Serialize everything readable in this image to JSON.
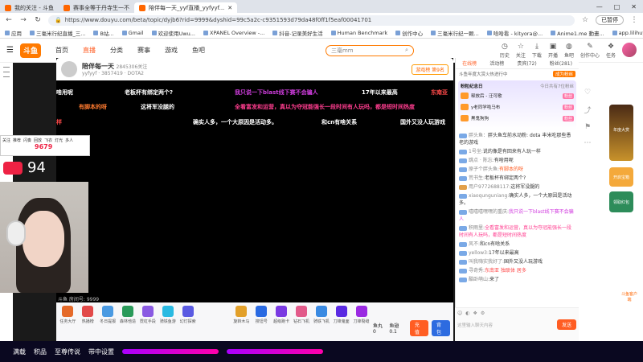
{
  "browser": {
    "tabs": [
      {
        "title": "我的关注 - 斗鱼"
      },
      {
        "title": "赛事全等于丹寺生一不"
      },
      {
        "title": "陪伴每一天_yyf直播_yyfyyf..."
      }
    ],
    "window_controls": [
      "—",
      "□",
      "✕"
    ],
    "url": "https://www.douyu.com/beta/topic/dyjb6?rid=9999&dyshid=99c5a2c-c9351593d79da48f0ff1f5eaf00041701",
    "profile_label": "已暂停",
    "bookmarks": [
      "应用",
      "三毫米行纪直播_三...",
      "B站...",
      "Gmail",
      "欢迎使用Uwu...",
      "XPANEL Overview -...",
      "抖音-记录美好生活",
      "Human Benchmark",
      "创作中心",
      "三毫米行纪一颗...",
      "哈哈看 - kityora@...",
      "Anime1.me 動畫...",
      "app.lilihuyu.com/..."
    ]
  },
  "site": {
    "logo": "斗鱼",
    "nav": [
      "首页",
      "直播",
      "分类",
      "赛事",
      "游戏",
      "鱼吧"
    ],
    "nav_active": 1,
    "search_placeholder": "三毫mm",
    "header_icons": [
      {
        "icon": "clock-icon",
        "label": "历史"
      },
      {
        "icon": "star-icon",
        "label": "关注"
      },
      {
        "icon": "download-icon",
        "label": "下载"
      },
      {
        "icon": "broadcast-icon",
        "label": "开播"
      },
      {
        "icon": "fish-icon",
        "label": "鱼吧"
      },
      {
        "icon": "pen-icon",
        "label": "创作中心"
      },
      {
        "icon": "gift-icon",
        "label": "任务"
      }
    ]
  },
  "stream": {
    "title": "陪伴每一天",
    "followers": "2845306关注",
    "anchor": "yyfyyf",
    "hot": "3857419",
    "category": "DOTA2",
    "rank": "游戏榜 第9名",
    "room_id": "斗鱼 房间号: 9999",
    "heart_rate": "94",
    "danmu": [
      {
        "text": "啥用呢",
        "color": "#ffffff"
      },
      {
        "text": "老板杯有绑定两个?",
        "color": "#ffffff"
      },
      {
        "text": "我只说一下blast线下赛不会骗人",
        "color": "#d13ddf"
      },
      {
        "text": "17年以来最高",
        "color": "#ffffff"
      },
      {
        "text": "东南亚",
        "color": "#ff4a4a"
      },
      {
        "text": "有脚本的呀",
        "color": "#ff7a2f"
      },
      {
        "text": "这将军没腿的",
        "color": "#ffffff"
      },
      {
        "text": "全看富发和运营，真以为夺冠能强长一段时间有人玩吗，都是短时间热度",
        "color": "#ff3d8f"
      },
      {
        "text": "样",
        "color": "#ff4a4a"
      },
      {
        "text": "确实人多，一个大原因是活动多。",
        "color": "#ffffff"
      },
      {
        "text": "和cn有啥关系",
        "color": "#ffffff"
      },
      {
        "text": "国外又没人玩游戏",
        "color": "#ffffff"
      }
    ],
    "overlay_text": [
      "关注",
      "推荐",
      "闪奏",
      "回放",
      "飞衣",
      "灯光",
      "多人"
    ],
    "overlay_number": "9679",
    "gifts": [
      {
        "label": "任务大厅",
        "color": "#e56a2a"
      },
      {
        "label": "热播榜",
        "color": "#e24a4a"
      },
      {
        "label": "冬日提报",
        "color": "#4a9ae2"
      },
      {
        "label": "森林他造",
        "color": "#2a9a5a"
      },
      {
        "label": "霓虹手段",
        "color": "#8a5ae2"
      },
      {
        "label": "骑铁鱼游",
        "color": "#2abae2"
      },
      {
        "label": "幻灯探索",
        "color": "#5a5ae2"
      },
      {
        "label": "旋转木马",
        "color": "#e2a02a"
      },
      {
        "label": "搜坦号",
        "color": "#2a6ae2"
      },
      {
        "label": "超级跑卡",
        "color": "#7a3ae2"
      },
      {
        "label": "钻石飞机",
        "color": "#e25a8a"
      },
      {
        "label": "骑铁飞机",
        "color": "#3a8ae2"
      },
      {
        "label": "刀锋鬼面",
        "color": "#5a2ae2"
      },
      {
        "label": "刀锋裂缝",
        "color": "#9a2ae2"
      }
    ],
    "fish_balls": "鱼丸 0",
    "fish_wings": "鱼翅 0.1",
    "charge_label": "充值",
    "bag_label": "背包"
  },
  "chat": {
    "tabs": [
      "在线榜",
      "活动榜",
      "贵宾(72)",
      "粉丝(281)"
    ],
    "active_tab": 0,
    "subline": "斗鱼年度大赏火热进行中",
    "follow_label": "成为粉丝",
    "fanclub_title": "粉粒纪念日",
    "fanclub_date": "今日共有7位粉丝",
    "fanclub_rows": [
      {
        "name": "释放后 - 汪可歌",
        "tag": "粉丝"
      },
      {
        "name": "y老同学啦马布",
        "tag": "粉丝"
      },
      {
        "name": "黑鬼狗狗",
        "tag": "粉丝"
      }
    ],
    "messages": [
      {
        "user": "胖头鱼：",
        "text": "胖头鱼车前水动粉: dota 丰米吃那些愚老的游戏"
      },
      {
        "user": "1号坐:",
        "text": "说的像是有回来有人玩一样"
      },
      {
        "user": "跳点 · 陈忘:",
        "text": "有啥用呢"
      },
      {
        "user": "原子个胖头鱼:",
        "text": "有脚本的呀"
      },
      {
        "user": "荒书生:",
        "text": "老板杯有绑定两个?"
      },
      {
        "user": "用户9772688117:",
        "text": "这将军没腿的"
      },
      {
        "user": "xiaoqunguniang:",
        "text": "确实人多，一个大原因是活动多。"
      },
      {
        "user": "嘻嘻嘻嘿嘿的重庆:",
        "text": "我只说一下blast线下赛不会骗人"
      },
      {
        "user": "积雨里:",
        "text": "全看富发和运营，真以为夺冠能强长一段时间有人玩吗，都是短时间热度"
      },
      {
        "user": "风不:",
        "text": "和cn有啥关系"
      },
      {
        "user": "yellow3:",
        "text": "17年以来最高"
      },
      {
        "user": "叫我嗨实我好了:",
        "text": "国外又没人玩游戏"
      },
      {
        "user": "寻奇秀:",
        "text": "东南亚 独联体 居多"
      },
      {
        "user": "酷卧萌山:",
        "text": "来了"
      }
    ],
    "input_placeholder": "这里输入聊天内容",
    "send_label": "发送"
  },
  "side": {
    "ad1": "年度大赏",
    "ad2": "开启宝箱",
    "ad3": "领取红包",
    "float_label": "斗鱼客户端"
  },
  "bottom": [
    "满载",
    "积品",
    "至尊传说",
    "带中设置"
  ]
}
